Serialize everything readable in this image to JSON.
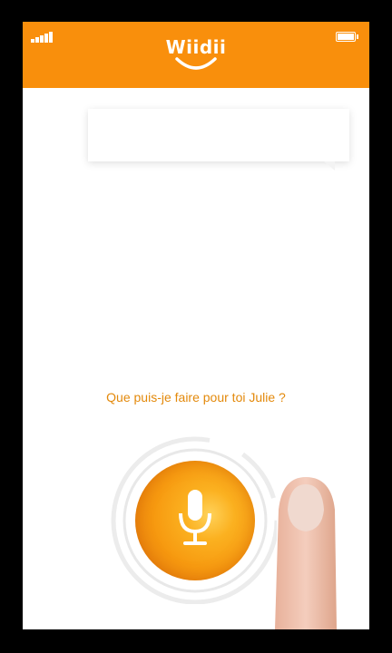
{
  "app": {
    "brand_name": "Wiidii",
    "brand_color": "#f98f0c"
  },
  "status_bar": {
    "signal_icon": "signal-bars-icon",
    "battery_icon": "battery-icon"
  },
  "chat": {
    "bubble_text": ""
  },
  "assistant": {
    "prompt": "Que puis-je faire pour toi Julie ?",
    "prompt_color": "#e3890b"
  },
  "voice": {
    "mic_icon": "microphone-icon"
  }
}
